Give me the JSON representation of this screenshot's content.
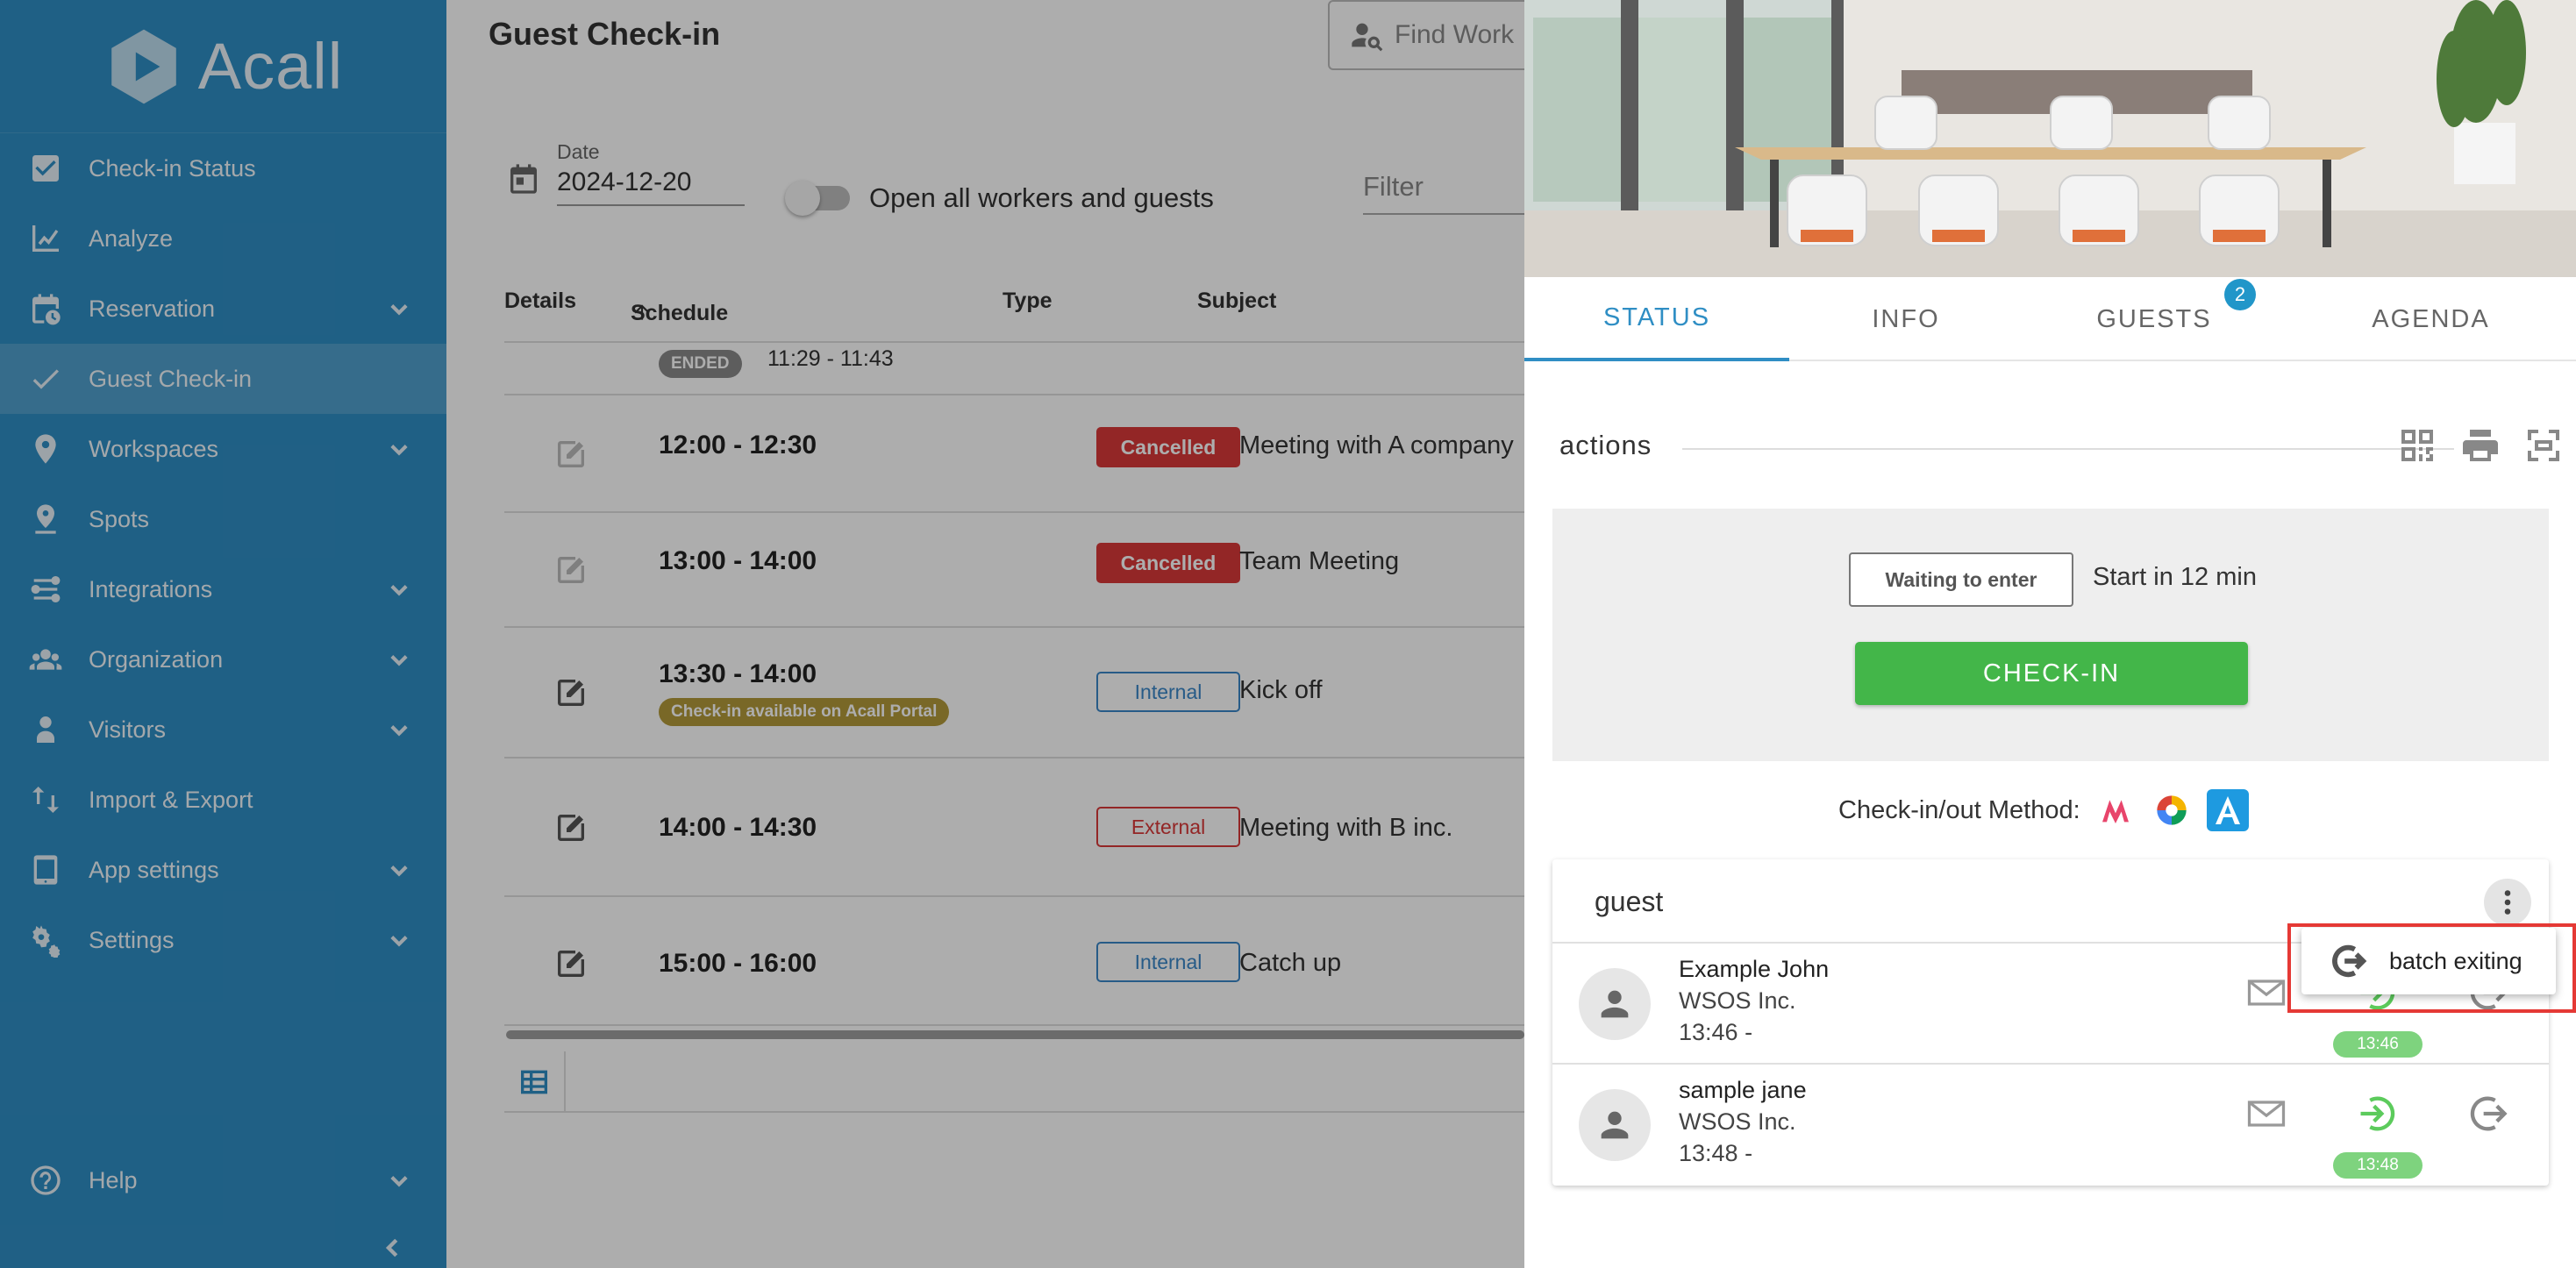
{
  "brand": {
    "name": "Acall"
  },
  "sidebar": {
    "items": [
      {
        "label": "Check-in Status",
        "icon": "checkbox-icon",
        "expandable": false
      },
      {
        "label": "Analyze",
        "icon": "chart-line-icon",
        "expandable": false
      },
      {
        "label": "Reservation",
        "icon": "calendar-clock-icon",
        "expandable": true
      },
      {
        "label": "Guest Check-in",
        "icon": "check-icon",
        "expandable": false,
        "active": true
      },
      {
        "label": "Workspaces",
        "icon": "location-pin-icon",
        "expandable": true
      },
      {
        "label": "Spots",
        "icon": "spot-pin-icon",
        "expandable": false
      },
      {
        "label": "Integrations",
        "icon": "integrations-icon",
        "expandable": true
      },
      {
        "label": "Organization",
        "icon": "people-icon",
        "expandable": true
      },
      {
        "label": "Visitors",
        "icon": "visitor-icon",
        "expandable": true
      },
      {
        "label": "Import & Export",
        "icon": "import-export-icon",
        "expandable": false
      },
      {
        "label": "App settings",
        "icon": "tablet-icon",
        "expandable": true
      },
      {
        "label": "Settings",
        "icon": "gears-icon",
        "expandable": true
      }
    ],
    "help": {
      "label": "Help",
      "icon": "help-circle-icon"
    }
  },
  "main": {
    "title": "Guest Check-in",
    "find_placeholder": "Find Work",
    "date_label": "Date",
    "date_value": "2024-12-20",
    "toggle_label": "Open all workers and guests",
    "filter_placeholder": "Filter",
    "columns": {
      "details": "Details",
      "schedule": "Schedule",
      "type": "Type",
      "subject": "Subject"
    },
    "rows": [
      {
        "time": "11:29 - 11:43",
        "pill": "ENDED",
        "type": "",
        "subject": ""
      },
      {
        "time": "12:00 - 12:30",
        "type": "Cancelled",
        "subject": "Meeting with A company"
      },
      {
        "time": "13:00 - 14:00",
        "type": "Cancelled",
        "subject": "Team Meeting"
      },
      {
        "time": "13:30 - 14:00",
        "pill": "Check-in available on Acall Portal",
        "type": "Internal",
        "subject": "Kick off"
      },
      {
        "time": "14:00 - 14:30",
        "type": "External",
        "subject": "Meeting with B inc."
      },
      {
        "time": "15:00 - 16:00",
        "type": "Internal",
        "subject": "Catch up"
      }
    ]
  },
  "panel": {
    "tabs": [
      {
        "label": "STATUS",
        "active": true
      },
      {
        "label": "INFO"
      },
      {
        "label": "GUESTS",
        "count": "2"
      },
      {
        "label": "AGENDA"
      }
    ],
    "actions_label": "actions",
    "status": {
      "waiting_label": "Waiting to enter",
      "start_text": "Start in 12 min",
      "checkin_button": "CHECK-IN"
    },
    "method_label": "Check-in/out Method:",
    "guest_section_title": "guest",
    "guests": [
      {
        "name": "Example John",
        "org": "WSOS Inc.",
        "time": "13:46  -",
        "stamp": "13:46"
      },
      {
        "name": "sample jane",
        "org": "WSOS Inc.",
        "time": "13:48  -",
        "stamp": "13:48"
      }
    ],
    "menu": {
      "batch_exit_label": "batch exiting"
    }
  },
  "colors": {
    "sidebar": "#2f8ec4",
    "accent": "#2f8ec4",
    "success": "#43b649",
    "danger": "#d93838",
    "highlight": "#e53935"
  }
}
